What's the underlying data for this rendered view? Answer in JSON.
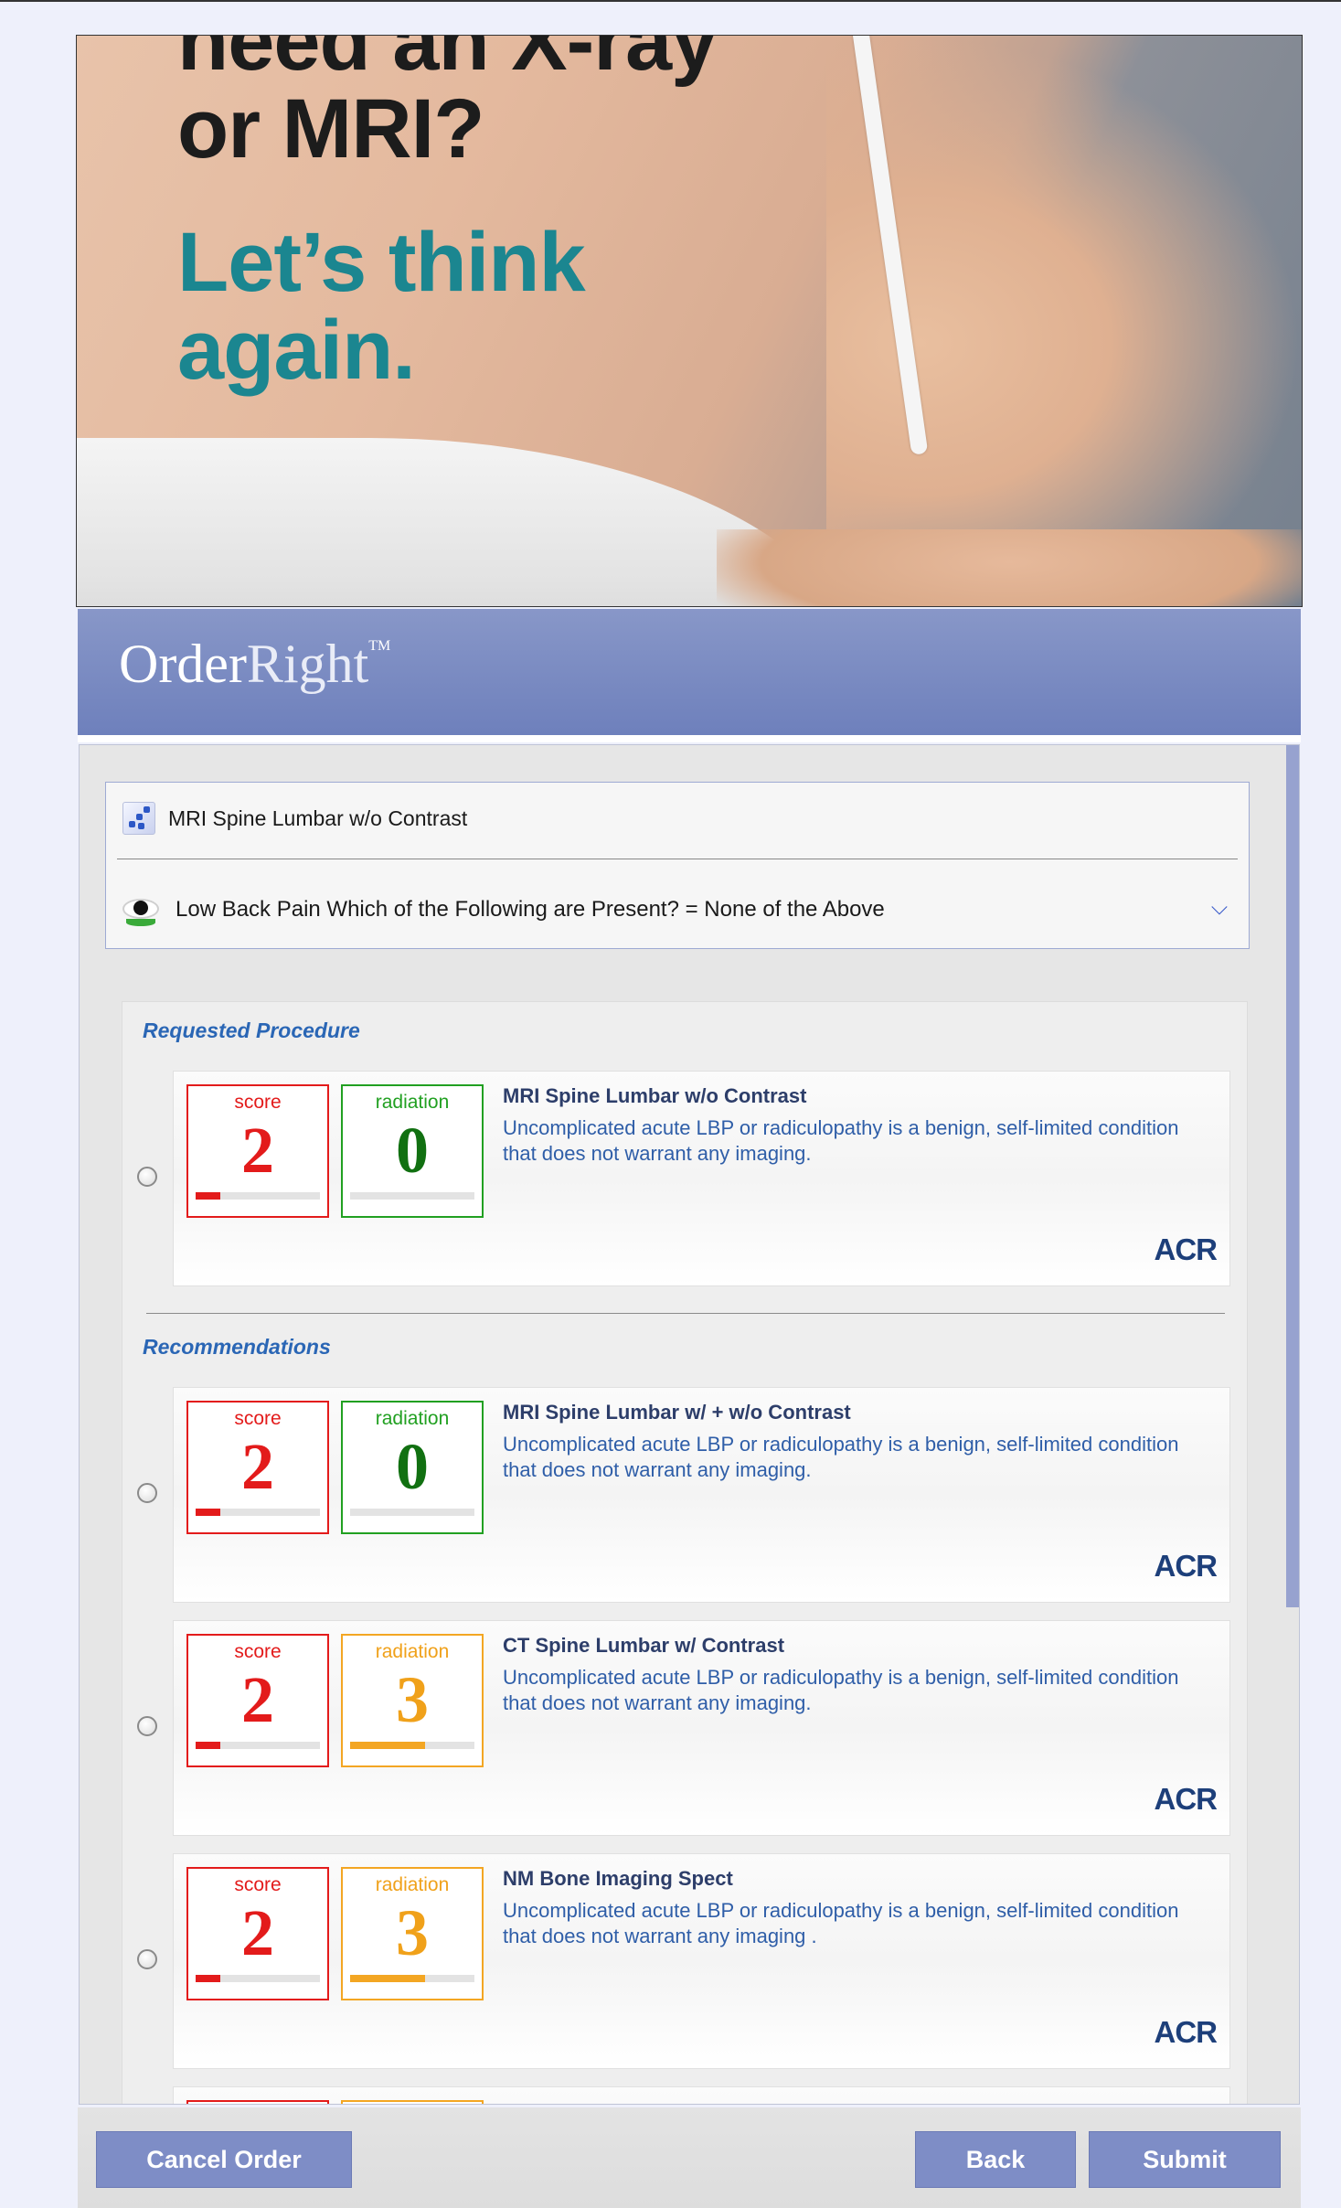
{
  "hero": {
    "line1": "need an X-ray\nor MRI?",
    "line2": "Let’s think\nagain."
  },
  "logo": {
    "order": "Order",
    "right": "Right",
    "tm": "TM"
  },
  "summary": {
    "procedure": "MRI Spine Lumbar w/o Contrast",
    "indication": "Low Back Pain Which of the Following are Present? = None of the Above"
  },
  "sections": {
    "requested": "Requested Procedure",
    "recommendations": "Recommendations"
  },
  "labels": {
    "score": "score",
    "radiation": "radiation",
    "acr": "ACR"
  },
  "requested": {
    "score": "2",
    "radiation": "0",
    "score_level": 0.2,
    "radiation_level": 0,
    "title": "MRI Spine Lumbar w/o Contrast",
    "desc": "Uncomplicated acute LBP or radiculopathy is a benign, self-limited condition that does not warrant any imaging."
  },
  "recommendations": [
    {
      "score": "2",
      "radiation": "0",
      "score_level": 0.2,
      "radiation_level": 0,
      "title": "MRI Spine Lumbar w/ + w/o Contrast",
      "desc": "Uncomplicated acute LBP or radiculopathy is a benign, self-limited condition that does not warrant any imaging."
    },
    {
      "score": "2",
      "radiation": "3",
      "score_level": 0.2,
      "radiation_level": 0.6,
      "title": "CT Spine Lumbar w/ Contrast",
      "desc": "Uncomplicated acute LBP or radiculopathy is a benign, self-limited condition that does not warrant any imaging."
    },
    {
      "score": "2",
      "radiation": "3",
      "score_level": 0.2,
      "radiation_level": 0.6,
      "title": "NM Bone Imaging Spect",
      "desc": "Uncomplicated acute LBP or radiculopathy is a benign, self-limited condition that does not warrant any imaging ."
    }
  ],
  "colors": {
    "accent": "#7e8dc6",
    "score": "#e31b1b",
    "radiation_low": "#21a021",
    "radiation_mid": "#f3a623",
    "link_text": "#2f5ea8"
  },
  "footer": {
    "cancel": "Cancel Order",
    "back": "Back",
    "submit": "Submit"
  }
}
